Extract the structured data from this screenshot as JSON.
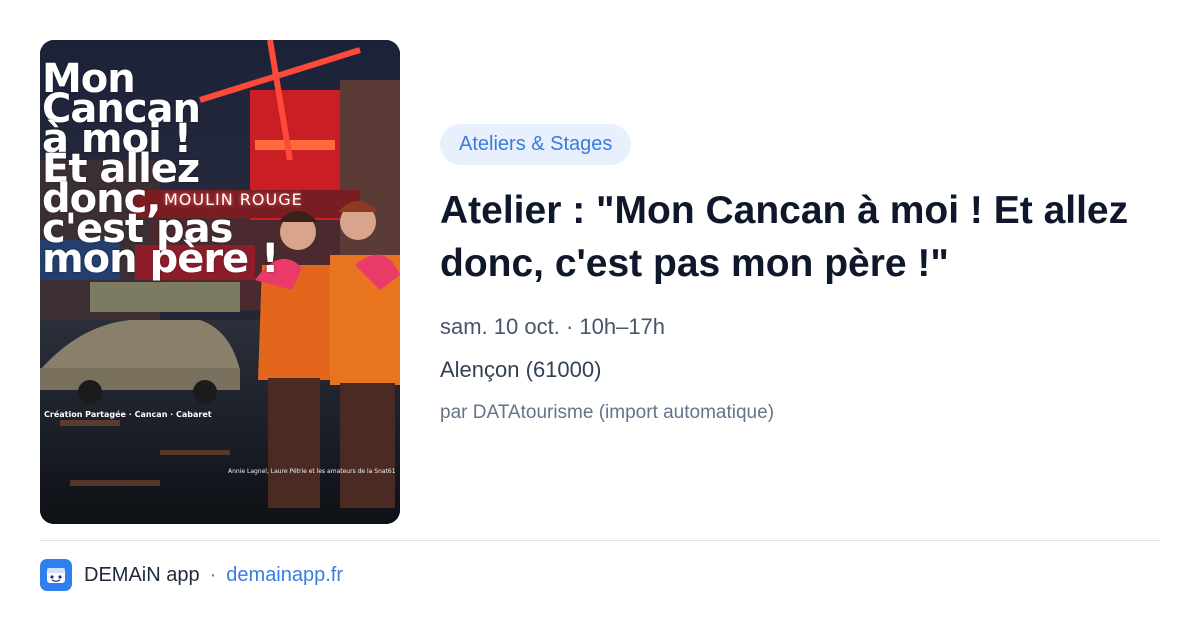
{
  "poster": {
    "title": "Mon\nCancan\nà moi !\nEt allez donc,\nc'est pas\nmon père !",
    "sign": "MOULIN ROUGE",
    "tagline": "Création Partagée · Cancan · Cabaret",
    "credits": "Annie Lagnel, Laure Pétrie et les amateurs de la Snat61"
  },
  "event": {
    "category": "Ateliers & Stages",
    "title": "Atelier : \"Mon Cancan à moi ! Et allez donc, c'est pas mon père !\"",
    "datetime": "sam. 10 oct. · 10h–17h",
    "location": "Alençon (61000)",
    "source": "par DATAtourisme (import automatique)"
  },
  "footer": {
    "app_name": "DEMAiN app",
    "separator": "·",
    "domain": "demainapp.fr"
  },
  "colors": {
    "accent": "#3a7be0",
    "badge_bg": "#e9f0fd",
    "title": "#0f172a"
  }
}
